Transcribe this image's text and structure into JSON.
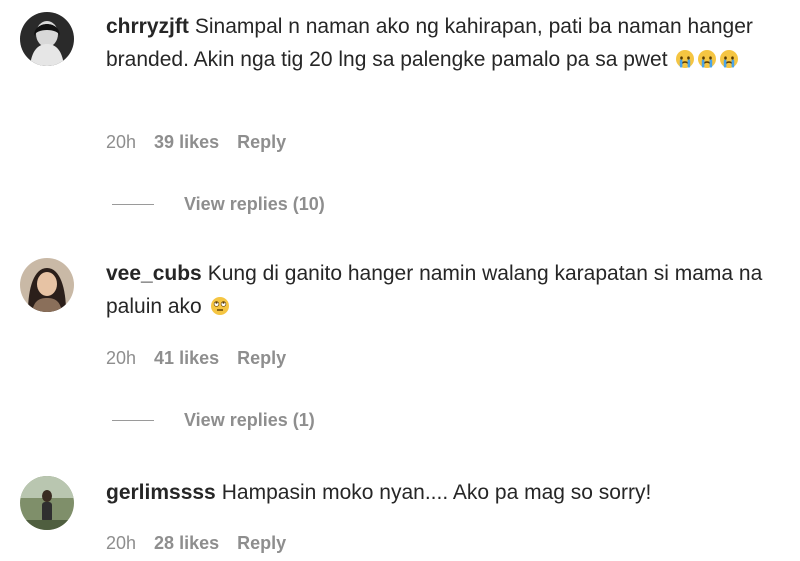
{
  "comments": [
    {
      "username": "chrryzjft",
      "text": "Sinampal n naman ako ng kahirapan, pati ba naman hanger branded. Akin nga tig 20 lng sa palengke pamalo pa sa pwet",
      "emojis": [
        "crying-face",
        "crying-face",
        "crying-face"
      ],
      "time": "20h",
      "likes": "39 likes",
      "reply": "Reply",
      "view_replies": "View replies (10)"
    },
    {
      "username": "vee_cubs",
      "text": "Kung di ganito hanger namin walang karapatan si mama na paluin ako",
      "emojis": [
        "eye-roll-face"
      ],
      "time": "20h",
      "likes": "41 likes",
      "reply": "Reply",
      "view_replies": "View replies (1)"
    },
    {
      "username": "gerlimssss",
      "text": "Hampasin moko nyan.... Ako pa mag so sorry!",
      "time": "20h",
      "likes": "28 likes",
      "reply": "Reply"
    }
  ],
  "colors": {
    "text": "#262626",
    "secondary": "#8e8e8e",
    "emoji": "#f5c542"
  }
}
